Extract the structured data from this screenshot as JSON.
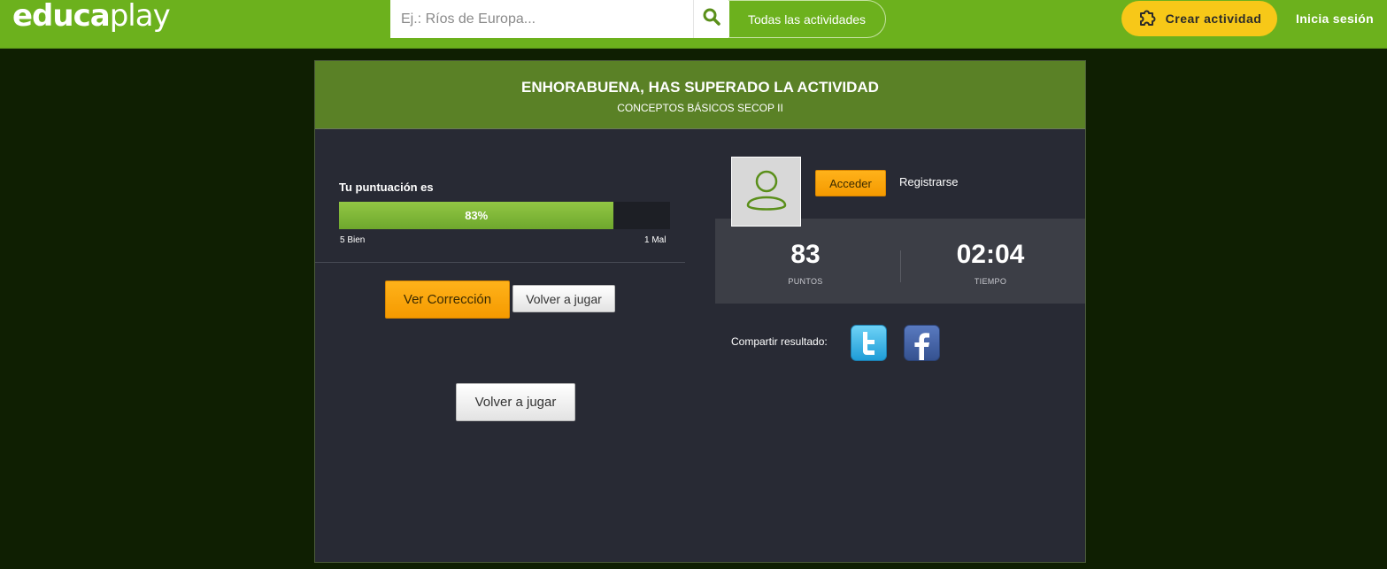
{
  "header": {
    "logo_bold": "educa",
    "logo_light": "play",
    "search_placeholder": "Ej.: Ríos de Europa...",
    "all_activities_label": "Todas las actividades",
    "create_label": "Crear actividad",
    "login_label": "Inicia sesión"
  },
  "result": {
    "title": "ENHORABUENA, HAS SUPERADO LA ACTIVIDAD",
    "subtitle": "CONCEPTOS BÁSICOS SECOP II",
    "score_label": "Tu puntuación es",
    "score_percent_text": "83%",
    "score_fraction": 0.83,
    "correct_text": "5 Bien",
    "wrong_text": "1 Mal",
    "view_correction_label": "Ver Corrección",
    "play_again_label": "Volver a jugar",
    "play_again_large_label": "Volver a jugar"
  },
  "user": {
    "access_label": "Acceder",
    "register_label": "Registrarse"
  },
  "stats": {
    "points_value": "83",
    "points_label": "PUNTOS",
    "time_value": "02:04",
    "time_label": "TIEMPO"
  },
  "share": {
    "label": "Compartir resultado:",
    "twitter_icon": "twitter-icon",
    "facebook_icon": "facebook-icon"
  },
  "colors": {
    "header_green": "#6cb11d",
    "panel_head_green": "#5a8126",
    "accent_yellow": "#f7c818",
    "button_orange": "#f59a00",
    "panel_dark": "#282a34"
  }
}
